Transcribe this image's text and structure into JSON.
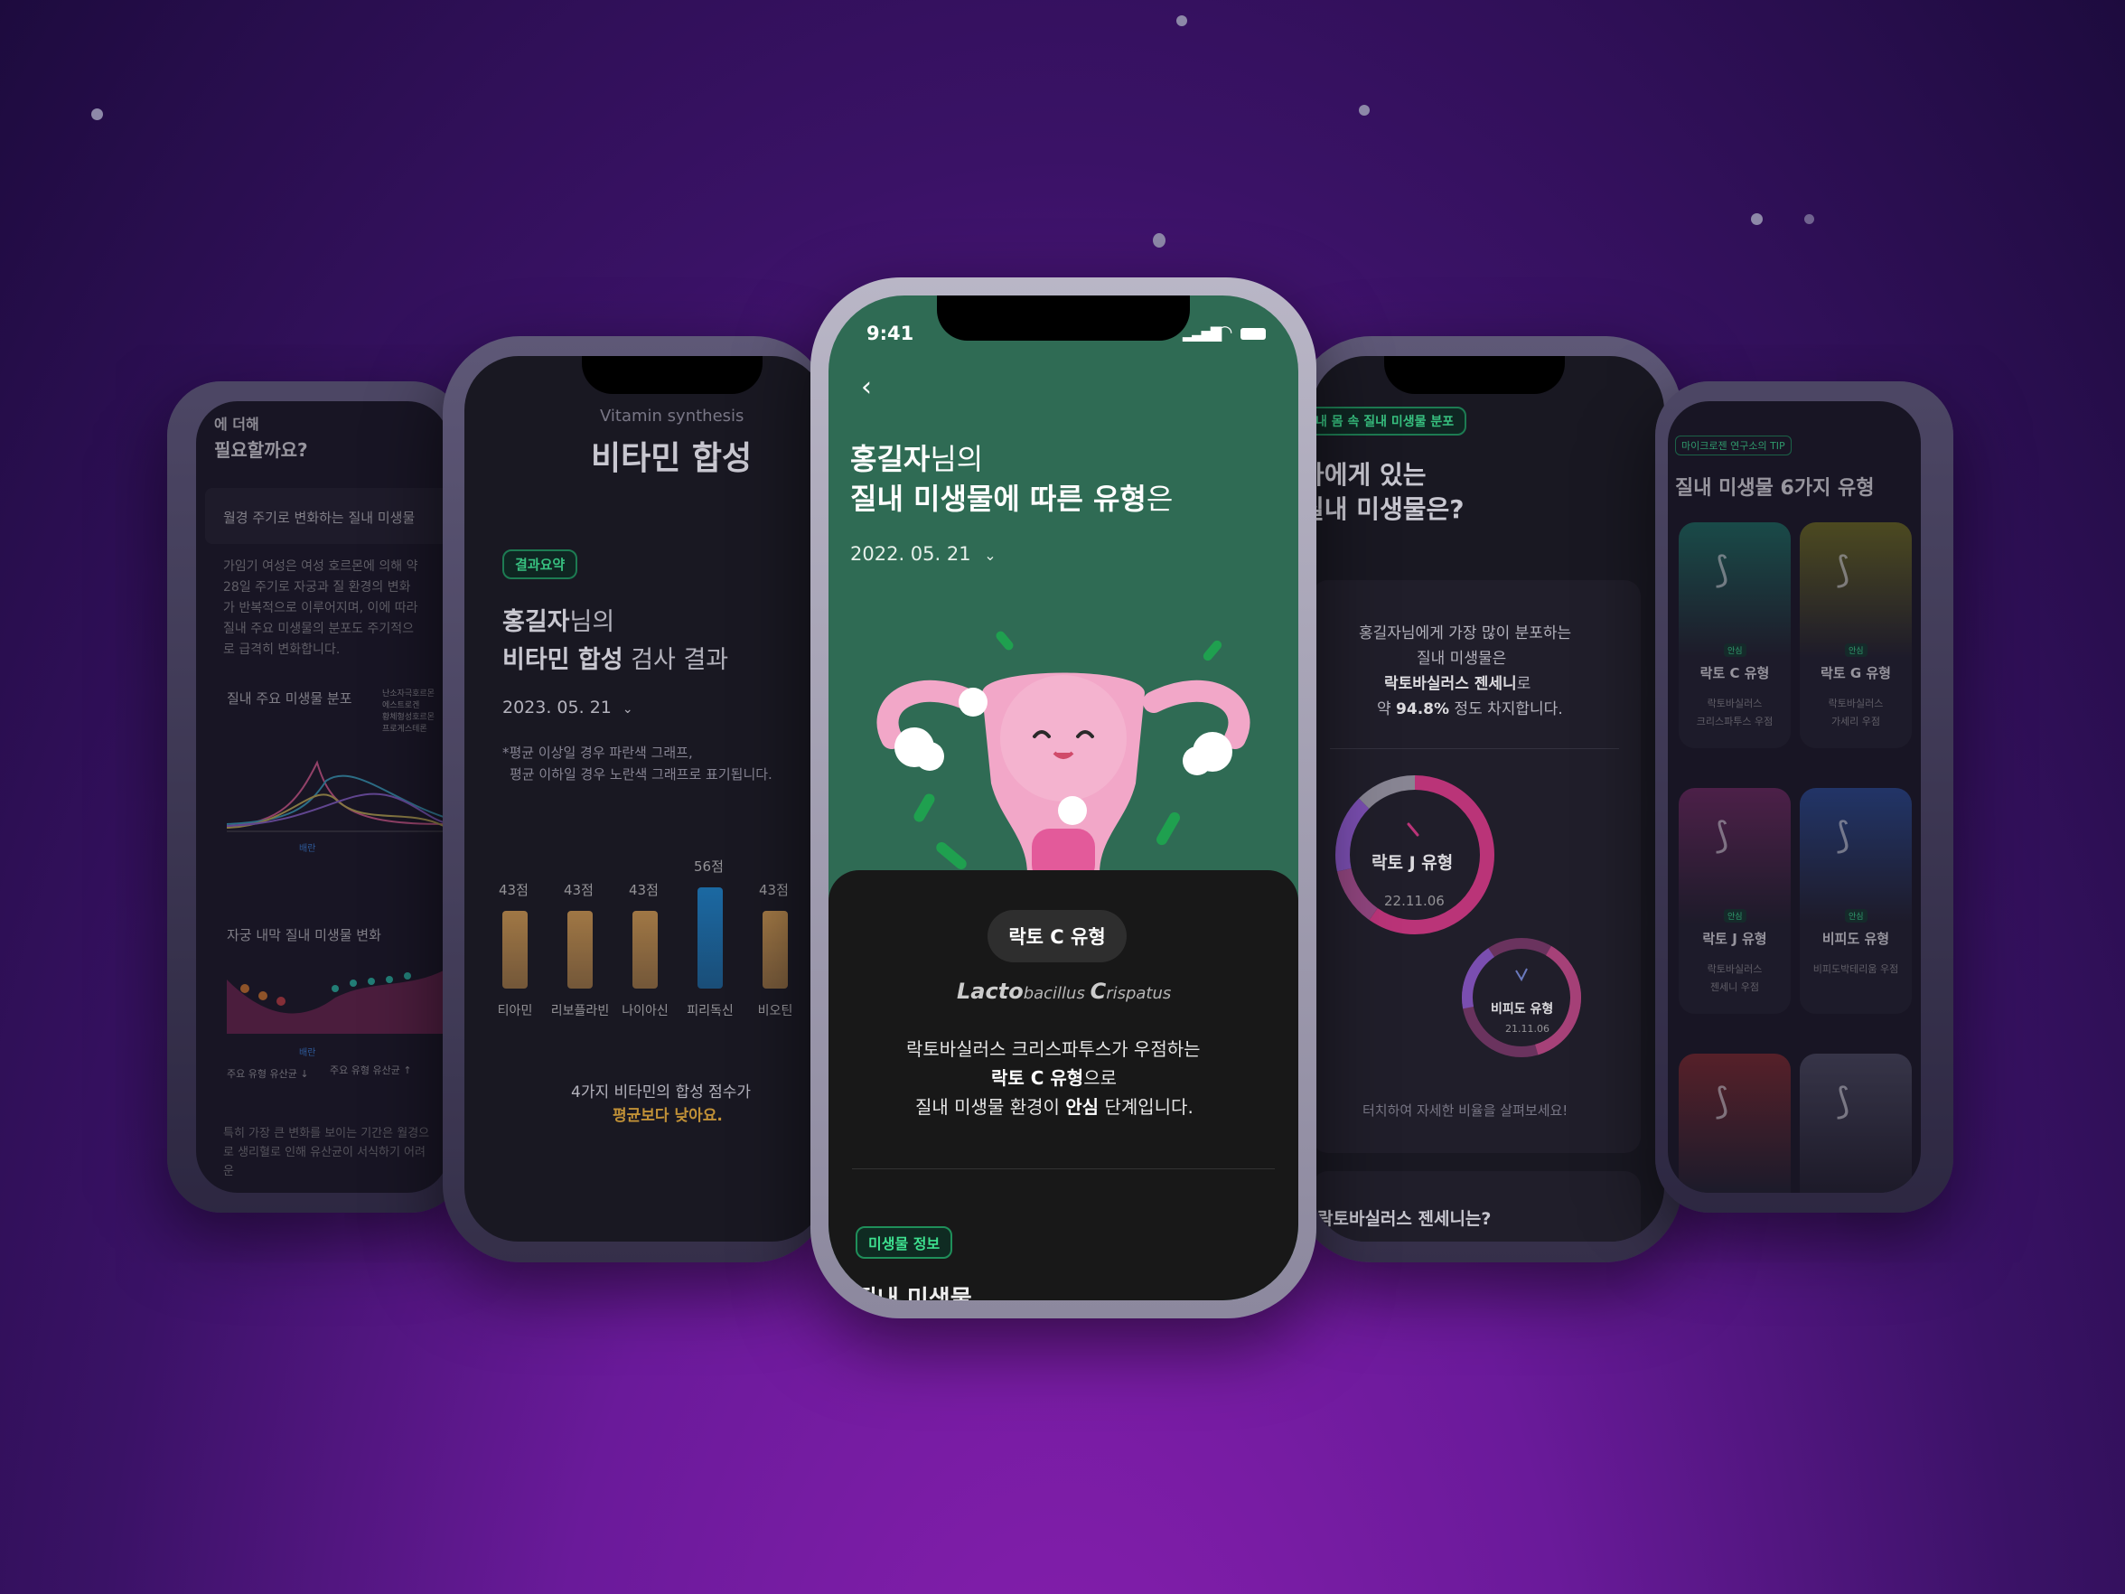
{
  "colors": {
    "accent_green": "#2f6b54",
    "tag_green": "#3ee08f",
    "orange": "#e0a93a",
    "bar_gold": "#b98a4a",
    "bar_blue": "#1d79b8",
    "pink": "#d83b87",
    "purple": "#8c5ac8"
  },
  "far_left": {
    "heading": "필요할까요?",
    "heading_partial": "에 더해",
    "section_title": "월경 주기로 변화하는 질내 미생물",
    "paragraph": "가임기 여성은 여성 호르몬에 의해 약 28일 주기로 자궁과 질 환경의 변화가 반복적으로 이루어지며, 이에 따라 질내 주요 미생물의 분포도 주기적으로 급격히 변화합니다.",
    "chart1_title": "질내 주요 미생물 분포",
    "chart1_x_label": "배란",
    "chart1_legend": [
      "난소자극호르몬",
      "에스트로겐",
      "황체형성호르몬",
      "프로게스테론"
    ],
    "chart2_title": "자궁 내막 질내 미생물 변화",
    "chart2_x_label": "배란",
    "legend_down": "주요 유형 유산균 ↓",
    "legend_up": "주요 유형 유산균 ↑",
    "footer": "특히 가장 큰 변화를 보이는 기간은 월경으로 생리혈로 인해 유산균이 서식하기 어려운"
  },
  "left": {
    "subtitle": "Vitamin synthesis",
    "title": "비타민 합성",
    "badge": "결과요약",
    "user_name": "홍길자",
    "user_suffix": "님의",
    "result_bold": "비타민 합성",
    "result_rest": " 검사 결과",
    "date": "2023. 05. 21",
    "note1": "*평균 이상일 경우 파란색 그래프,",
    "note2": "평균 이하일 경우 노란색 그래프로 표기됩니다.",
    "summary1": "4가지 비타민의 합성 점수가",
    "summary2": "평균보다 낮아요."
  },
  "chart_data": {
    "type": "bar",
    "categories": [
      "티아민",
      "리보플라빈",
      "나이아신",
      "피리독신",
      "비오틴"
    ],
    "values": [
      43,
      43,
      43,
      56,
      43
    ],
    "value_labels": [
      "43점",
      "43점",
      "43점",
      "56점",
      "43점"
    ],
    "ylim": [
      0,
      70
    ]
  },
  "center": {
    "status_time": "9:41",
    "user_name": "홍길자",
    "user_suffix": "님의",
    "title_bold": "질내 미생물에 따른 유형",
    "title_suffix": "은",
    "date": "2022. 05. 21",
    "type_badge": "락토 C 유형",
    "scientific_lacto": "Lacto",
    "scientific_bacillus": "bacillus ",
    "scientific_c": "C",
    "scientific_rispatus": "rispatus",
    "desc_line1": "락토바실러스 크리스파투스가 우점하는",
    "desc_bold": "락토 C 유형",
    "desc_line2_suffix": "으로",
    "desc_line3_prefix": "질내 미생물 환경이 ",
    "desc_bold2": "안심",
    "desc_line3_suffix": " 단계입니다.",
    "info_badge": "미생물 정보",
    "cutoff_text": "질내 미생물"
  },
  "right": {
    "tag": "내 몸 속 질내 미생물 분포",
    "heading1": "나에게 있는",
    "heading2": "질내 미생물은?",
    "desc1": "홍길자님에게 가장 많이 분포하는",
    "desc2": "질내 미생물은",
    "desc3_bold": "락토바실러스 젠세니",
    "desc3_suffix": "로",
    "desc4_prefix": "약 ",
    "desc4_bold": "94.8%",
    "desc4_suffix": " 정도 차지합니다.",
    "donut1_label": "락토 J 유형",
    "donut1_date": "22.11.06",
    "donut2_label": "비피도 유형",
    "donut2_date": "21.11.06",
    "hint": "터치하여 자세한 비율을 살펴보세요!",
    "bottom_heading": "락토바실러스 젠세니는?"
  },
  "far_right": {
    "tag": "마이크로젠 연구소의 TIP",
    "heading": "질내 미생물 6가지 유형",
    "cards": [
      {
        "tag": "안심",
        "title": "락토 C 유형",
        "sub1": "락토바실러스",
        "sub2": "크리스파투스 우점",
        "color": "#1d6b5a"
      },
      {
        "tag": "안심",
        "title": "락토 G 유형",
        "sub1": "락토바실러스",
        "sub2": "가세리 우점",
        "color": "#6b6a1d"
      },
      {
        "tag": "안심",
        "title": "락토 J 유형",
        "sub1": "락토바실러스",
        "sub2": "젠세니 우점",
        "color": "#6b2a5a"
      },
      {
        "tag": "안심",
        "title": "비피도 유형",
        "sub1": "비피도박테리움 우점",
        "sub2": "",
        "color": "#2a4a8a"
      },
      {
        "tag": "",
        "title": "",
        "sub1": "",
        "sub2": "",
        "color": "#7a2a2a"
      },
      {
        "tag": "",
        "title": "",
        "sub1": "",
        "sub2": "",
        "color": "#4a4a5a"
      }
    ]
  }
}
